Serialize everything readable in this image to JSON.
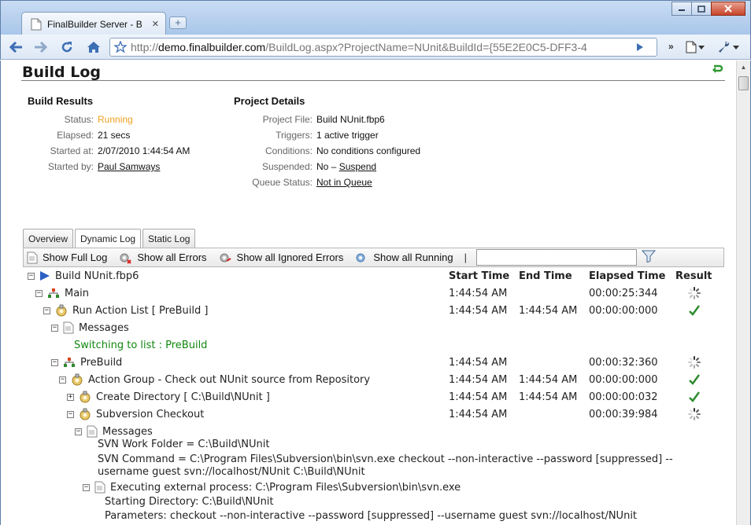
{
  "browser": {
    "tab_title": "FinalBuilder Server - Buil...",
    "tab_close": "✕",
    "new_tab": "+",
    "url_scheme": "http://",
    "url_host": "demo.finalbuilder.com",
    "url_path": "/BuildLog.aspx?ProjectName=NUnit&BuildId={55E2E0C5-DFF3-4",
    "more": "»"
  },
  "page": {
    "title": "Build Log"
  },
  "build_results": {
    "heading": "Build Results",
    "rows": [
      {
        "label": "Status:",
        "value": "Running"
      },
      {
        "label": "Elapsed:",
        "value": "21 secs"
      },
      {
        "label": "Started at:",
        "value": "2/07/2010 1:44:54 AM"
      },
      {
        "label": "Started by:",
        "value": "Paul Samways"
      }
    ]
  },
  "project_details": {
    "heading": "Project Details",
    "rows": [
      {
        "label": "Project File:",
        "value": "Build NUnit.fbp6"
      },
      {
        "label": "Triggers:",
        "value": "1 active trigger"
      },
      {
        "label": "Conditions:",
        "value": "No conditions configured"
      },
      {
        "label": "Suspended:",
        "value": "No – ",
        "link": "Suspend"
      },
      {
        "label": "Queue Status:",
        "value": "Not in Queue"
      }
    ]
  },
  "log_tabs": [
    "Overview",
    "Dynamic Log",
    "Static Log"
  ],
  "log_toolbar": {
    "full_log": "Show Full Log",
    "all_errors": "Show all Errors",
    "ignored_errors": "Show all Ignored Errors",
    "all_running": "Show all Running",
    "separator": "|",
    "filter_value": ""
  },
  "tree": {
    "root": "Build NUnit.fbp6",
    "columns": [
      "Start Time",
      "End Time",
      "Elapsed Time",
      "Result"
    ],
    "rows": [
      {
        "name": "Main",
        "start": "1:44:54 AM",
        "end": "",
        "elapsed": "00:00:25:344",
        "result": "running"
      },
      {
        "name": "Run Action List [ PreBuild ]",
        "start": "1:44:54 AM",
        "end": "1:44:54 AM",
        "elapsed": "00:00:00:000",
        "result": "success"
      },
      {
        "name": "Messages"
      },
      {
        "name": "Switching to list : PreBuild"
      },
      {
        "name": "PreBuild",
        "start": "1:44:54 AM",
        "end": "",
        "elapsed": "00:00:32:360",
        "result": "running"
      },
      {
        "name": "Action Group - Check out NUnit source from Repository",
        "start": "1:44:54 AM",
        "end": "1:44:54 AM",
        "elapsed": "00:00:00:000",
        "result": "success"
      },
      {
        "name": "Create Directory [ C:\\Build\\NUnit ]",
        "start": "1:44:54 AM",
        "end": "1:44:54 AM",
        "elapsed": "00:00:00:032",
        "result": "success"
      },
      {
        "name": "Subversion Checkout",
        "start": "1:44:54 AM",
        "end": "",
        "elapsed": "00:00:39:984",
        "result": "running"
      },
      {
        "name": "Messages"
      }
    ],
    "messages": [
      "SVN Work Folder = C:\\Build\\NUnit",
      "SVN Command = C:\\Program Files\\Subversion\\bin\\svn.exe checkout --non-interactive --password [suppressed] --",
      "username guest  svn://localhost/NUnit C:\\Build\\NUnit",
      "Executing external process: C:\\Program Files\\Subversion\\bin\\svn.exe",
      "Starting Directory: C:\\Build\\NUnit",
      "Parameters: checkout --non-interactive --password [suppressed] --username guest  svn://localhost/NUnit"
    ]
  },
  "colors": {
    "running": "#f0a020",
    "success": "#2e8b2e",
    "message_green": "#118811"
  }
}
